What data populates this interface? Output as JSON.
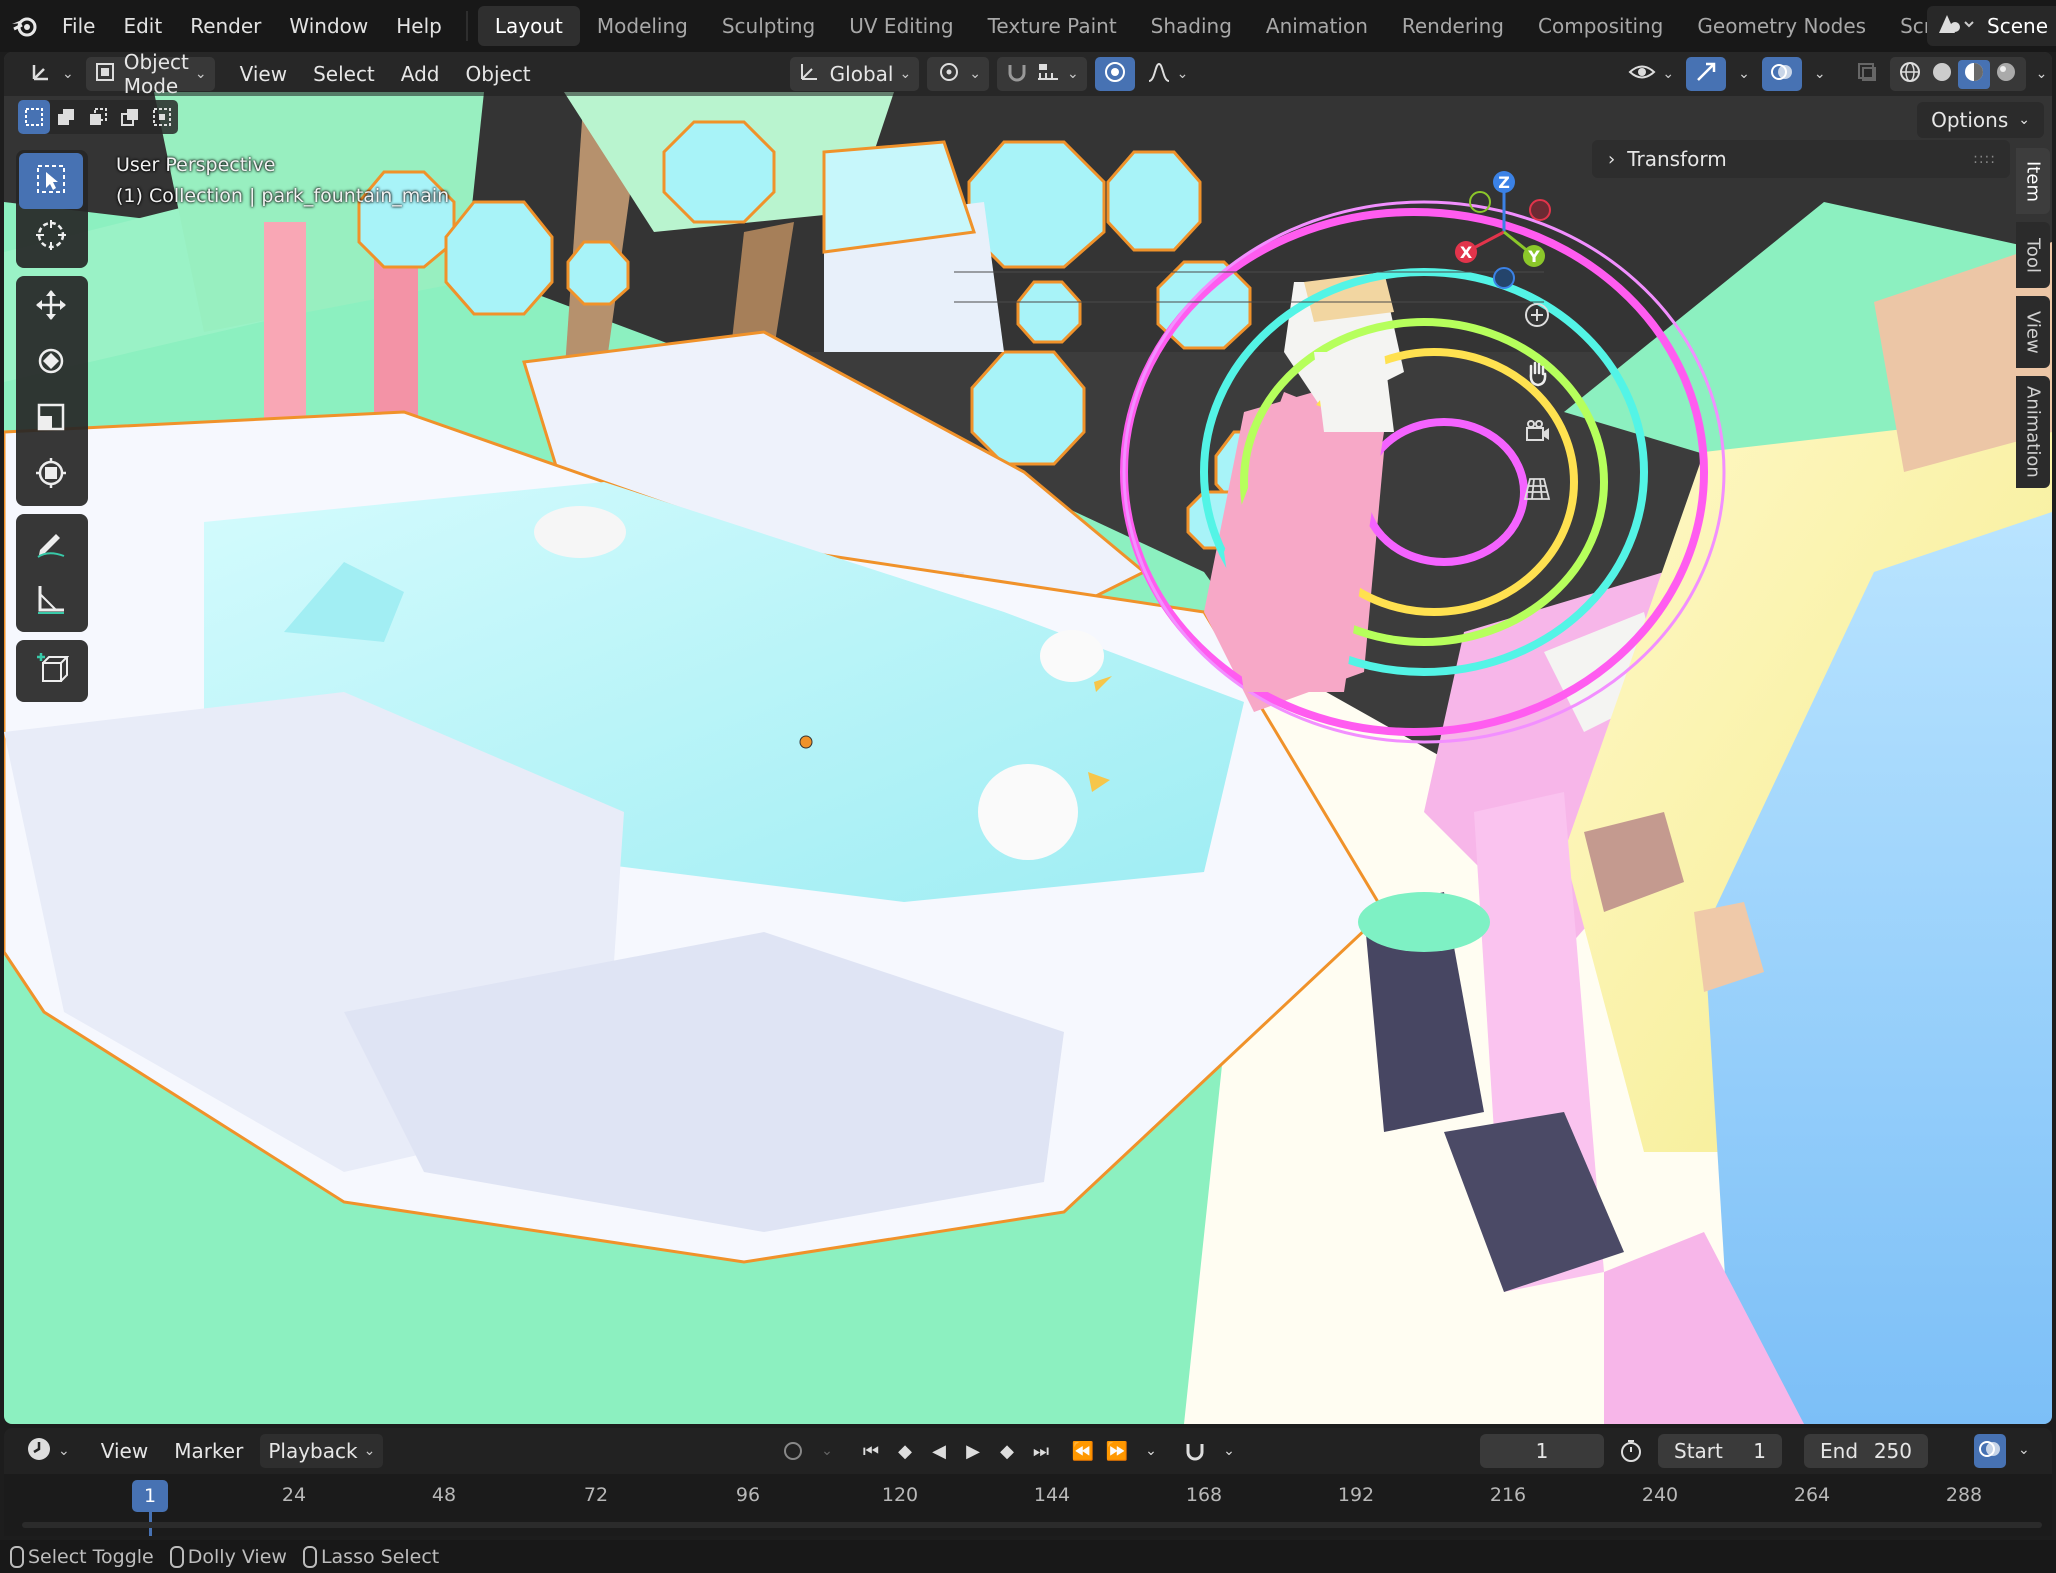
{
  "menu": [
    "File",
    "Edit",
    "Render",
    "Window",
    "Help"
  ],
  "workspaces": [
    "Layout",
    "Modeling",
    "Sculpting",
    "UV Editing",
    "Texture Paint",
    "Shading",
    "Animation",
    "Rendering",
    "Compositing",
    "Geometry Nodes",
    "Scripting"
  ],
  "active_workspace": "Layout",
  "scene_name": "Scene",
  "viewport_header": {
    "mode": "Object Mode",
    "menus": [
      "View",
      "Select",
      "Add",
      "Object"
    ],
    "transform_orientation": "Global",
    "options_label": "Options"
  },
  "overlay": {
    "view_name": "User Perspective",
    "collection_line": "(1) Collection | park_fountain_main"
  },
  "n_panel": {
    "section": "Transform",
    "tabs": [
      "Item",
      "Tool",
      "View",
      "Animation"
    ],
    "active_tab": "Item"
  },
  "gizmo_axes": [
    "X",
    "Y",
    "Z"
  ],
  "tools": [
    "select-box",
    "cursor",
    "move",
    "rotate",
    "scale",
    "transform",
    "annotate",
    "measure",
    "add-cube"
  ],
  "timeline": {
    "menus": [
      "View",
      "Marker"
    ],
    "playback_label": "Playback",
    "current_frame": "1",
    "start_label": "Start",
    "start_value": "1",
    "end_label": "End",
    "end_value": "250",
    "ruler_labels": [
      "1",
      "24",
      "48",
      "72",
      "96",
      "120",
      "144",
      "168",
      "192",
      "216",
      "240",
      "264",
      "288"
    ]
  },
  "statusbar": [
    "Select Toggle",
    "Dolly View",
    "Lasso Select"
  ],
  "colors": {
    "accent": "#4772b3",
    "selection_outline": "#f0922a",
    "water": "#b6f1f5",
    "grass": "#86f0bc"
  }
}
